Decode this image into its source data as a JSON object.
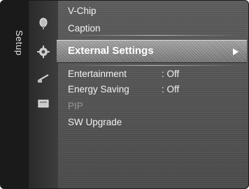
{
  "sidebar": {
    "title": "Setup"
  },
  "icons": [
    "satellite-dish-icon",
    "gear-icon",
    "input-plug-icon",
    "app-icon"
  ],
  "menu": {
    "items": [
      {
        "label": "V-Chip",
        "value": ""
      },
      {
        "label": "Caption",
        "value": ""
      },
      {
        "label": "External Settings",
        "value": "",
        "selected": true
      },
      {
        "label": "Entertainment",
        "value": ": Off"
      },
      {
        "label": "Energy Saving",
        "value": ": Off"
      },
      {
        "label": "PIP",
        "value": "",
        "disabled": true
      },
      {
        "label": "SW Upgrade",
        "value": ""
      }
    ]
  }
}
